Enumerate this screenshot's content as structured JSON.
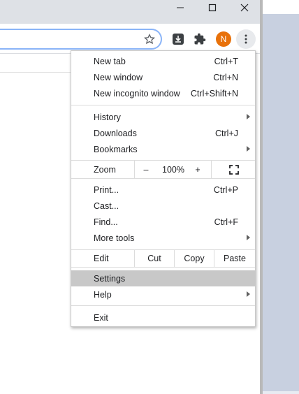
{
  "window_controls": {
    "minimize": "minimize-icon",
    "maximize": "maximize-icon",
    "close": "close-icon"
  },
  "toolbar": {
    "profile_initial": "N",
    "accent_color": "#e8710a",
    "icons": [
      "star-icon",
      "download-icon",
      "puzzle-icon",
      "kebab-icon"
    ]
  },
  "menu": {
    "group1": [
      {
        "label": "New tab",
        "shortcut": "Ctrl+T"
      },
      {
        "label": "New window",
        "shortcut": "Ctrl+N"
      },
      {
        "label": "New incognito window",
        "shortcut": "Ctrl+Shift+N"
      }
    ],
    "group2": [
      {
        "label": "History",
        "shortcut": ""
      },
      {
        "label": "Downloads",
        "shortcut": "Ctrl+J"
      },
      {
        "label": "Bookmarks",
        "shortcut": ""
      }
    ],
    "zoom": {
      "label": "Zoom",
      "minus": "–",
      "value": "100%",
      "plus": "+"
    },
    "group3": [
      {
        "label": "Print...",
        "shortcut": "Ctrl+P"
      },
      {
        "label": "Cast...",
        "shortcut": ""
      },
      {
        "label": "Find...",
        "shortcut": "Ctrl+F"
      },
      {
        "label": "More tools",
        "shortcut": ""
      }
    ],
    "edit": {
      "label": "Edit",
      "cut": "Cut",
      "copy": "Copy",
      "paste": "Paste"
    },
    "group4": [
      {
        "label": "Settings"
      },
      {
        "label": "Help"
      }
    ],
    "exit": "Exit",
    "highlight_color": "#c8c8c8"
  }
}
